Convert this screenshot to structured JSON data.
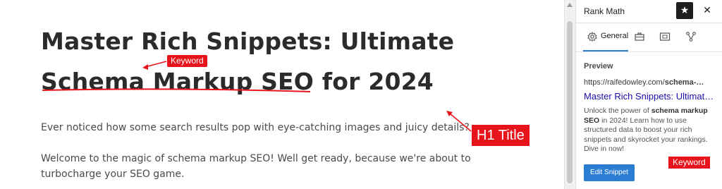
{
  "post": {
    "title": "Master Rich Snippets: Ultimate Schema Markup SEO for 2024",
    "title_line1": "Master Rich Snippets: Ultimate",
    "title_line2": "Schema Markup SEO for 2024",
    "paragraphs": [
      "Ever noticed how some search results pop with eye-catching images and juicy details?",
      "Welcome to the magic of schema markup SEO!  Well get ready, because we're about to turbocharge your SEO game."
    ]
  },
  "annotations": {
    "keyword_label": "Keyword",
    "h1_label": "H1 Title",
    "keyword_label_sidebar": "Keyword",
    "color": "#e8141b"
  },
  "sidebar": {
    "title": "Rank Math",
    "star_icon": "star-icon",
    "close_icon": "close-icon",
    "tabs": [
      {
        "label": "General",
        "icon": "gear-icon",
        "active": true
      },
      {
        "label": "",
        "icon": "toolbox-icon"
      },
      {
        "label": "",
        "icon": "media-icon"
      },
      {
        "label": "",
        "icon": "schema-icon"
      }
    ],
    "preview": {
      "heading": "Preview",
      "url_prefix": "https://raifedowley.com/",
      "url_bold": "schema-…",
      "title": "Master Rich Snippets: Ultimat…",
      "desc_part1": "Unlock the power of ",
      "desc_bold1": "schema markup",
      "desc_bold2": "SEO",
      "desc_part2": " in 2024! Learn how to use structured data to boost your rich snippets and skyrocket your rankings. Dive in now!"
    },
    "edit_button": "Edit Snippet",
    "accent": "#2b7cd3"
  }
}
